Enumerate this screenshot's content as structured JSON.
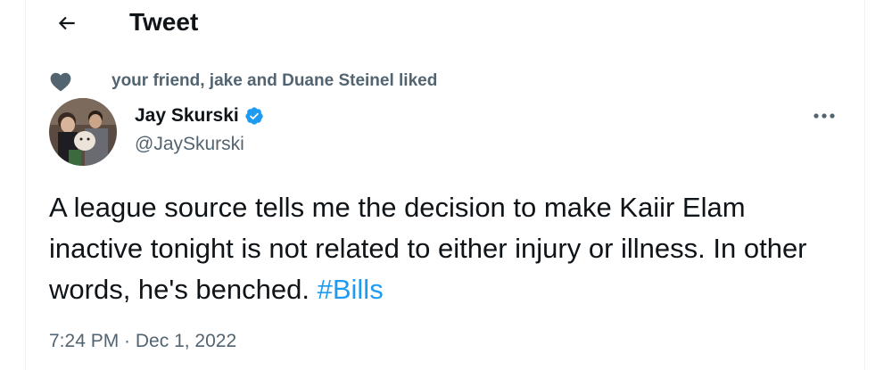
{
  "header": {
    "title": "Tweet",
    "back_icon": "arrow-left-icon"
  },
  "social_context": {
    "icon": "heart-icon",
    "text": "your friend, jake and Duane Steinel liked"
  },
  "author": {
    "display_name": "Jay Skurski",
    "handle": "@JaySkurski",
    "verified_icon": "verified-badge-icon"
  },
  "tweet": {
    "text_part1": "A league source tells me the decision to make Kaiir Elam inactive tonight is not related to either injury or illness. In other words, he's benched. ",
    "hashtag": "#Bills",
    "time": "7:24 PM",
    "separator": " · ",
    "date": "Dec 1, 2022"
  },
  "colors": {
    "accent": "#1d9bf0",
    "text": "#0f1419",
    "secondary": "#536471"
  }
}
